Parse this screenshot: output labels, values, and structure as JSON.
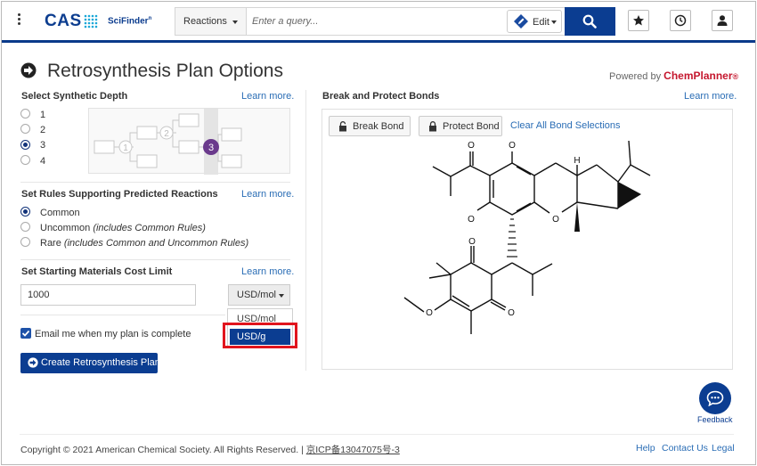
{
  "header": {
    "logo_text": "CAS",
    "product_text": "SciFinder",
    "product_mark": "n",
    "search_type": "Reactions",
    "search_placeholder": "Enter a query...",
    "edit_label": "Edit",
    "icons": [
      "menu-kebab-icon",
      "search-icon",
      "star-icon",
      "history-clock-icon",
      "user-icon"
    ]
  },
  "page": {
    "title": "Retrosynthesis Plan Options",
    "powered_by": "Powered by",
    "powered_brand": "ChemPlanner",
    "powered_mark": "®"
  },
  "depth": {
    "heading": "Select Synthetic Depth",
    "learn_more": "Learn more.",
    "options": [
      "1",
      "2",
      "3",
      "4"
    ],
    "selected": "3",
    "diagram_steps": [
      "1",
      "2",
      "3"
    ]
  },
  "rules": {
    "heading": "Set Rules Supporting Predicted Reactions",
    "learn_more": "Learn more.",
    "options": [
      {
        "label": "Common",
        "note": ""
      },
      {
        "label": "Uncommon",
        "note": "(includes Common Rules)"
      },
      {
        "label": "Rare",
        "note": "(includes Common and Uncommon Rules)"
      }
    ],
    "selected": "Common"
  },
  "cost": {
    "heading": "Set Starting Materials Cost Limit",
    "learn_more": "Learn more.",
    "value": "1000",
    "unit_selected": "USD/mol",
    "unit_options": [
      "USD/mol",
      "USD/g"
    ],
    "unit_highlighted": "USD/g"
  },
  "email": {
    "label": "Email me when my plan is complete",
    "checked": true
  },
  "create_button": "Create Retrosynthesis Plan",
  "bonds": {
    "heading": "Break and Protect Bonds",
    "learn_more": "Learn more.",
    "break_label": "Break Bond",
    "protect_label": "Protect Bond",
    "clear_label": "Clear All Bond Selections",
    "atom_labels": {
      "o_ketone_top": "O",
      "o_phenol_top": "O",
      "h_stereo": "H",
      "o_phenol_left": "O",
      "o_ring": "O",
      "o_lower_quinone_top": "O",
      "o_methoxy": "O",
      "o_lower_quinone_bottom": "O"
    }
  },
  "feedback": {
    "label": "Feedback"
  },
  "footer": {
    "copyright": "Copyright © 2021 American Chemical Society. All Rights Reserved. |",
    "icp": "京ICP备13047075号-3",
    "links": [
      "Help",
      "Contact Us",
      "Legal"
    ]
  },
  "colors": {
    "brand_blue": "#0b3d91",
    "link_blue": "#2a6db5",
    "chemplanner_red": "#c5172e",
    "highlight_red": "#e1141d",
    "depth_marker_purple": "#6a3a8c"
  }
}
